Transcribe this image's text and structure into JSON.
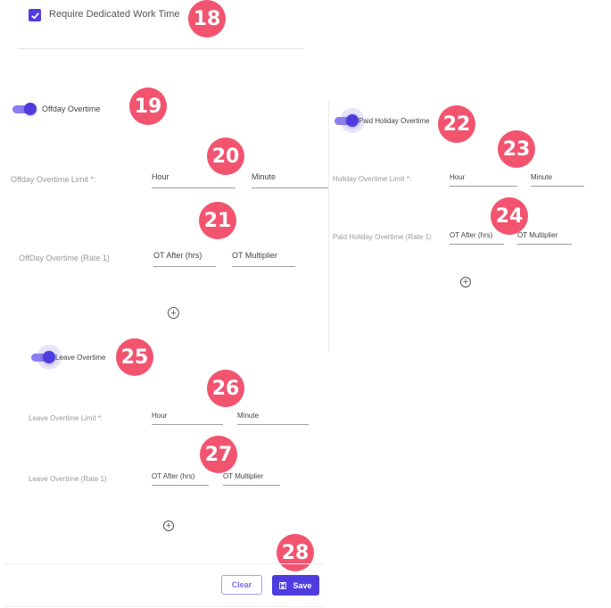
{
  "dedicated_work_time": {
    "label": "Require Dedicated Work Time",
    "checked": true
  },
  "offday": {
    "toggle_label": "Offday Overtime",
    "enabled": true,
    "limit_label": "Offday Overtime Limit *:",
    "hour_placeholder": "Hour",
    "minute_placeholder": "Minute",
    "rate_label": "OffDay Overtime (Rate 1)",
    "ot_after_placeholder": "OT After (hrs)",
    "ot_multiplier_placeholder": "OT Multiplier",
    "add_icon": "plus-circle-icon"
  },
  "holiday": {
    "toggle_label": "Paid Holiday Overtime",
    "enabled": true,
    "limit_label": "Holiday Overtime Limit *:",
    "hour_placeholder": "Hour",
    "minute_placeholder": "Minute",
    "rate_label": "Paid Holiday Overtime (Rate 1)",
    "ot_after_placeholder": "OT After (hrs)",
    "ot_multiplier_placeholder": "OT Multiplier",
    "add_icon": "plus-circle-icon"
  },
  "leave": {
    "toggle_label": "Leave Overtime",
    "enabled": true,
    "limit_label": "Leave Overtime Limit *:",
    "hour_placeholder": "Hour",
    "minute_placeholder": "Minute",
    "rate_label": "Leave Overtime (Rate 1)",
    "ot_after_placeholder": "OT After (hrs)",
    "ot_multiplier_placeholder": "OT Multiplier",
    "add_icon": "plus-circle-icon"
  },
  "footer": {
    "clear_label": "Clear",
    "save_label": "Save",
    "save_icon": "floppy-disk-icon"
  },
  "badges": [
    "18",
    "19",
    "20",
    "21",
    "22",
    "23",
    "24",
    "25",
    "26",
    "27",
    "28"
  ],
  "colors": {
    "accent": "#4f3ce0",
    "badge": "#f2546f"
  }
}
